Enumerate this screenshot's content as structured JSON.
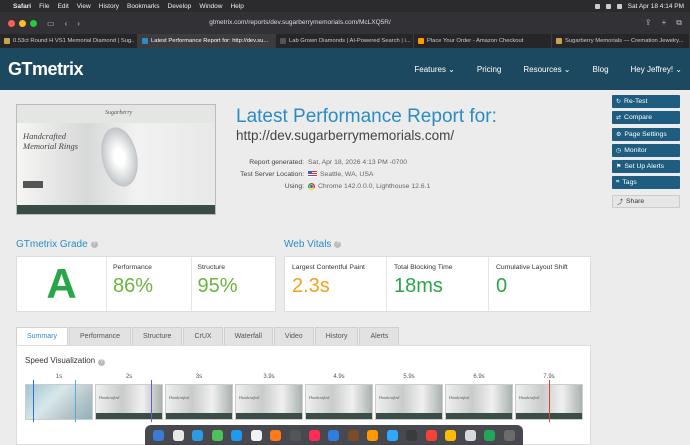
{
  "menubar": {
    "app": "Safari",
    "items": [
      "File",
      "Edit",
      "View",
      "History",
      "Bookmarks",
      "Develop",
      "Window",
      "Help"
    ],
    "datetime": "Sat Apr 18  4:14 PM"
  },
  "browser": {
    "url": "gtmetrix.com/reports/dev.sugarberrymemorials.com/McLXQ5R/",
    "tabs": [
      {
        "label": "0.53ct Round H VS1 Memorial Diamond | Sug..",
        "active": false,
        "color": "#c9a24c"
      },
      {
        "label": "Latest Performance Report for: http://dev.su...",
        "active": true,
        "color": "#2b8cc4"
      },
      {
        "label": "Lab Grown Diamonds | AI-Powered Search | i...",
        "active": false,
        "color": "#555555"
      },
      {
        "label": "Place Your Order - Amazon Checkout",
        "active": false,
        "color": "#ff9900"
      },
      {
        "label": "Sugarberry Memorials — Cremation Jewelry...",
        "active": false,
        "color": "#c9a24c"
      }
    ]
  },
  "header": {
    "logo": "GTmetrix",
    "nav": {
      "features": "Features ⌄",
      "pricing": "Pricing",
      "resources": "Resources ⌄",
      "blog": "Blog",
      "user": "Hey Jeffrey! ⌄"
    }
  },
  "screenshot": {
    "logo": "Sugarberry",
    "hero_line1": "Handcrafted",
    "hero_line2": "Memorial Rings"
  },
  "report": {
    "title": "Latest Performance Report for:",
    "url": "http://dev.sugarberrymemorials.com/",
    "generated_label": "Report generated:",
    "generated_value": "Sat, Apr 18, 2026 4:13 PM -0700",
    "location_label": "Test Server Location:",
    "location_value": "Seattle, WA, USA",
    "using_label": "Using:",
    "using_value": "Chrome 142.0.0.0, Lighthouse 12.6.1"
  },
  "actions": {
    "retest": "Re-Test",
    "compare": "Compare",
    "page_settings": "Page Settings",
    "monitor": "Monitor",
    "alerts": "Set Up Alerts",
    "tags": "Tags",
    "share": "Share"
  },
  "grade": {
    "title": "GTmetrix Grade",
    "letter": "A",
    "performance_label": "Performance",
    "performance_value": "86%",
    "structure_label": "Structure",
    "structure_value": "95%"
  },
  "vitals": {
    "title": "Web Vitals",
    "lcp_label": "Largest Contentful Paint",
    "lcp_value": "2.3s",
    "tbt_label": "Total Blocking Time",
    "tbt_value": "18ms",
    "cls_label": "Cumulative Layout Shift",
    "cls_value": "0",
    "colors": {
      "lcp": "#f0a21b",
      "tbt": "#27a74a",
      "cls": "#27a74a"
    }
  },
  "page_tabs": [
    "Summary",
    "Performance",
    "Structure",
    "CrUX",
    "Waterfall",
    "Video",
    "History",
    "Alerts"
  ],
  "speed": {
    "title": "Speed Visualization",
    "frames": [
      "1s",
      "2s",
      "3s",
      "3.9s",
      "4.9s",
      "5.9s",
      "6.9s",
      "7.9s"
    ]
  },
  "colors": {
    "brand_dark": "#1d4960",
    "accent_blue": "#2b8cc4",
    "grade_green": "#27a74a",
    "score_green": "#6cb33f"
  }
}
